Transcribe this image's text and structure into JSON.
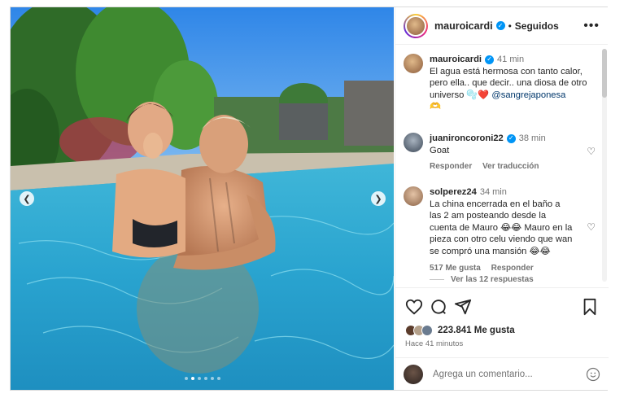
{
  "post": {
    "carousel": {
      "dot_count": 6,
      "active_index": 1
    },
    "header": {
      "username": "mauroicardi",
      "separator": "•",
      "follow_status": "Seguidos",
      "more_icon": "more-horizontal-icon"
    },
    "caption": {
      "username": "mauroicardi",
      "time": "41 min",
      "text": "El agua está hermosa con tanto calor, pero ella.. que decir.. una diosa de otro universo 🫧❤️",
      "mention": "@sangrejaponesa",
      "trailing_emoji": "🫶"
    },
    "comments": [
      {
        "username": "juanironcoroni22",
        "time": "38 min",
        "text": "Goat",
        "reply_label": "Responder",
        "translate_label": "Ver traducción"
      },
      {
        "username": "solperez24",
        "time": "34 min",
        "text": "La china encerrada en el baño a las 2 am posteando desde la cuenta de Mauro 😂😂 Mauro en la pieza con otro celu viendo que wan se compró una mansión 😂😂",
        "likes_label": "517 Me gusta",
        "reply_label": "Responder",
        "view_replies": "Ver las 12 respuestas"
      }
    ],
    "likes": "223.841 Me gusta",
    "posted_ago": "Hace 41 minutos",
    "add_comment_placeholder": "Agrega un comentario...",
    "colors": {
      "verified": "#0095f6",
      "mention": "#00376b",
      "muted": "#737373"
    }
  }
}
